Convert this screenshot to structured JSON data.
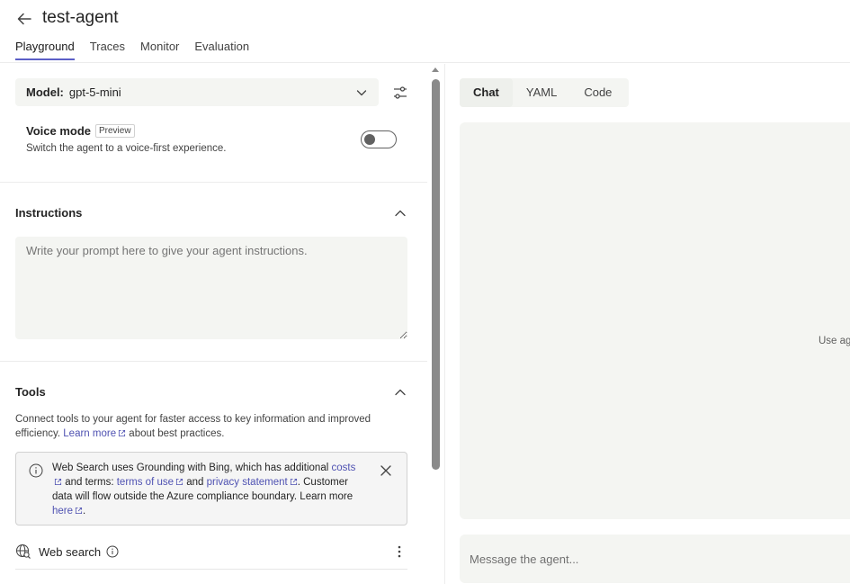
{
  "header": {
    "title": "test-agent",
    "tabs": [
      {
        "label": "Playground"
      },
      {
        "label": "Traces"
      },
      {
        "label": "Monitor"
      },
      {
        "label": "Evaluation"
      }
    ],
    "active_tab": "Playground"
  },
  "model": {
    "label": "Model:",
    "value": "gpt-5-mini"
  },
  "voice": {
    "title": "Voice mode",
    "badge": "Preview",
    "description": "Switch the agent to a voice-first experience.",
    "enabled": false
  },
  "instructions": {
    "title": "Instructions",
    "placeholder": "Write your prompt here to give your agent instructions."
  },
  "tools": {
    "title": "Tools",
    "desc_1": "Connect tools to your agent for faster access to key information and improved efficiency.",
    "learn_more": "Learn more",
    "desc_2": "about best practices.",
    "alert": {
      "text_1": "Web Search uses Grounding with Bing, which has additional",
      "link_costs": "costs",
      "text_2": "and terms:",
      "link_terms": "terms of use",
      "text_3": "and",
      "link_privacy": "privacy statement",
      "text_4": ". Customer data will flow outside the Azure compliance boundary. Learn more",
      "link_here": "here",
      "text_5": "."
    },
    "web_search_label": "Web search"
  },
  "right": {
    "tabs": [
      {
        "label": "Chat"
      },
      {
        "label": "YAML"
      },
      {
        "label": "Code"
      }
    ],
    "active_tab": "Chat",
    "chat_hint": "Use ag",
    "message_placeholder": "Message the agent..."
  },
  "colors": {
    "accent": "#5b5fc7",
    "link": "#4f52b2",
    "panel_bg": "#f4f5f2"
  }
}
